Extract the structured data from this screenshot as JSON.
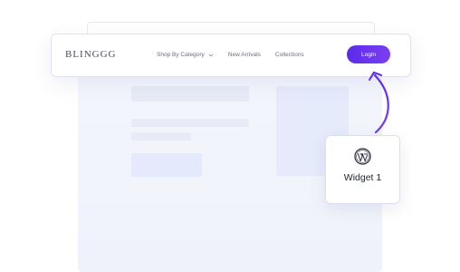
{
  "navbar": {
    "brand": "BLINGGG",
    "links": [
      {
        "label": "Shop By Category",
        "has_dropdown": true
      },
      {
        "label": "New Arrivals",
        "has_dropdown": false
      },
      {
        "label": "Collections",
        "has_dropdown": false
      }
    ],
    "login_label": "Login"
  },
  "widget": {
    "icon": "wordpress-icon",
    "label": "Widget 1"
  },
  "colors": {
    "accent_start": "#5b2be8",
    "accent_end": "#7b3ff2",
    "arrow": "#6a34ee"
  }
}
